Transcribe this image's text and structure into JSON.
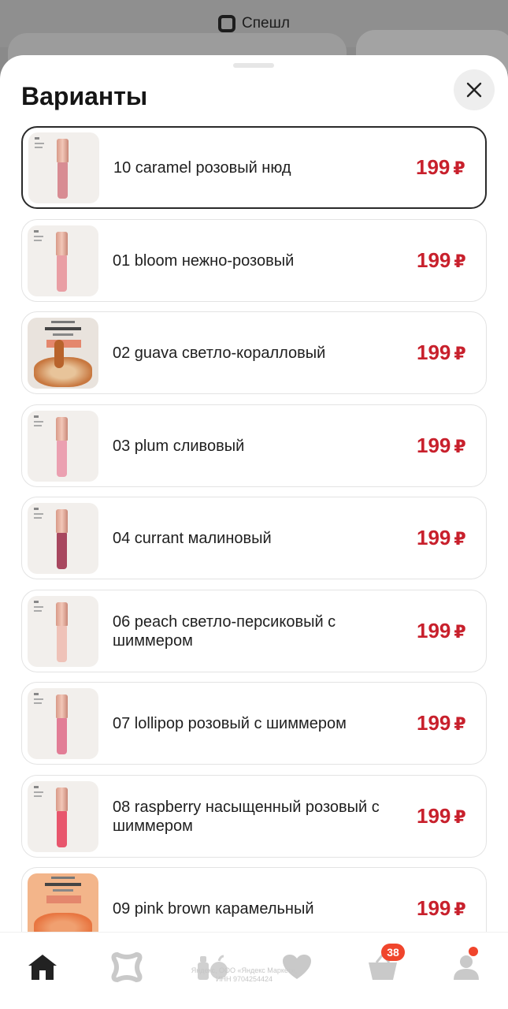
{
  "background": {
    "top_label": "Спешл",
    "icon": "special-icon"
  },
  "sheet": {
    "title": "Варианты",
    "close_icon": "close-icon"
  },
  "variants": [
    {
      "name": "10 caramel розовый нюд",
      "price": "199",
      "currency": "₽",
      "selected": true,
      "color": "#d88c93"
    },
    {
      "name": "01 bloom нежно-розовый",
      "price": "199",
      "currency": "₽",
      "selected": false,
      "color": "#e99ea4"
    },
    {
      "name": "02 guava светло-коралловый",
      "price": "199",
      "currency": "₽",
      "selected": false,
      "color": "#e08a7c"
    },
    {
      "name": "03 plum сливовый",
      "price": "199",
      "currency": "₽",
      "selected": false,
      "color": "#eba0b1"
    },
    {
      "name": "04 currant малиновый",
      "price": "199",
      "currency": "₽",
      "selected": false,
      "color": "#a8475f"
    },
    {
      "name": "06 peach светло-персиковый с шиммером",
      "price": "199",
      "currency": "₽",
      "selected": false,
      "color": "#efc2b8"
    },
    {
      "name": "07 lollipop розовый с шиммером",
      "price": "199",
      "currency": "₽",
      "selected": false,
      "color": "#e27d96"
    },
    {
      "name": "08 raspberry насыщенный розовый с шиммером",
      "price": "199",
      "currency": "₽",
      "selected": false,
      "color": "#e8566d"
    },
    {
      "name": "09 pink brown карамельный",
      "price": "199",
      "currency": "₽",
      "selected": false,
      "color": "#d98a62"
    }
  ],
  "nav": {
    "items": [
      {
        "icon": "home-icon"
      },
      {
        "icon": "special-icon"
      },
      {
        "icon": "catalog-icon"
      },
      {
        "icon": "heart-icon"
      },
      {
        "icon": "cart-icon"
      },
      {
        "icon": "profile-icon"
      }
    ],
    "cart_badge": "38",
    "legal_text": "Яндекс, ООО «Яндекс Маркет», ИНН 9704254424"
  },
  "colors": {
    "price": "#c8202c",
    "badge": "#f0452c"
  }
}
